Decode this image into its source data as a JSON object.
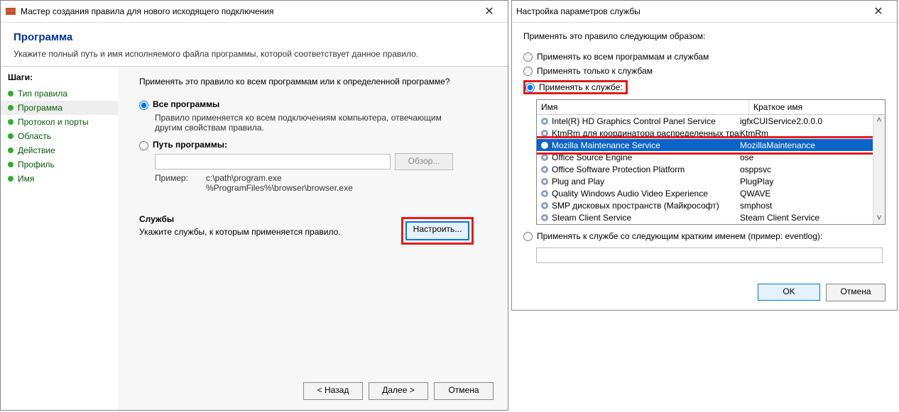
{
  "left": {
    "title": "Мастер создания правила для нового исходящего подключения",
    "heading": "Программа",
    "sub": "Укажите полный путь и имя исполняемого файла программы, которой соответствует данное правило.",
    "steps_header": "Шаги:",
    "steps": [
      {
        "label": "Тип правила"
      },
      {
        "label": "Программа"
      },
      {
        "label": "Протокол и порты"
      },
      {
        "label": "Область"
      },
      {
        "label": "Действие"
      },
      {
        "label": "Профиль"
      },
      {
        "label": "Имя"
      }
    ],
    "question": "Применять это правило ко всем программам или к определенной программе?",
    "opt_all": "Все программы",
    "opt_all_desc": "Правило применяется ко всем подключениям компьютера, отвечающим другим свойствам правила.",
    "opt_path": "Путь программы:",
    "browse": "Обзор...",
    "example_label": "Пример:",
    "example_text": "c:\\path\\program.exe\n%ProgramFiles%\\browser\\browser.exe",
    "services_header": "Службы",
    "services_desc": "Укажите службы, к которым применяется правило.",
    "configure_btn": "Настроить...",
    "btn_back": "< Назад",
    "btn_next": "Далее >",
    "btn_cancel": "Отмена"
  },
  "right": {
    "title": "Настройка параметров службы",
    "apply_label": "Применять это правило следующим образом:",
    "opt_all": "Применять ко всем программам и службам",
    "opt_services": "Применять только к службам",
    "opt_service": "Применять к службе:",
    "col_name": "Имя",
    "col_short": "Краткое имя",
    "rows": [
      {
        "name": "Intel(R) HD Graphics Control Panel Service",
        "short": "igfxCUIService2.0.0.0"
      },
      {
        "name": "KtmRm для координатора распределенных транза",
        "short": "KtmRm"
      },
      {
        "name": "Mozilla Maintenance Service",
        "short": "MozillaMaintenance"
      },
      {
        "name": "Office  Source Engine",
        "short": "ose"
      },
      {
        "name": "Office Software Protection Platform",
        "short": "osppsvc"
      },
      {
        "name": "Plug and Play",
        "short": "PlugPlay"
      },
      {
        "name": "Quality Windows Audio Video Experience",
        "short": "QWAVE"
      },
      {
        "name": "SMP дисковых пространств (Майкрософт)",
        "short": "smphost"
      },
      {
        "name": "Steam Client Service",
        "short": "Steam Client Service"
      }
    ],
    "opt_shortname": "Применять к службе со следующим кратким именем (пример: eventlog):",
    "btn_ok": "OK",
    "btn_cancel": "Отмена"
  }
}
